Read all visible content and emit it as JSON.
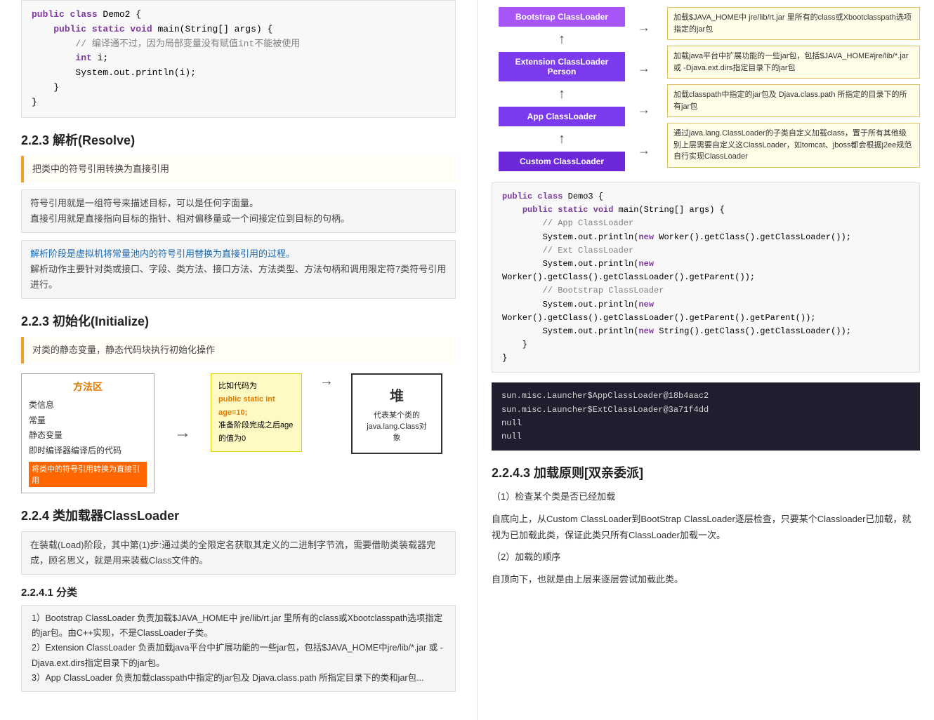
{
  "left": {
    "code_top": {
      "lines": [
        {
          "text": "public class Demo2 {",
          "type": "normal"
        },
        {
          "text": "    public static void main(String[] args) {",
          "type": "normal"
        },
        {
          "text": "        // 编译通不过，因为局部变量没有赋值int不能被使用",
          "type": "comment"
        },
        {
          "text": "        int i;",
          "type": "indent"
        },
        {
          "text": "        System.out.println(i);",
          "type": "indent"
        },
        {
          "text": "    }",
          "type": "normal"
        },
        {
          "text": "}",
          "type": "normal"
        }
      ]
    },
    "section_223": {
      "title": "2.2.3 解析(Resolve)",
      "infobox": "把类中的符号引用转换为直接引用",
      "box1_line1": "符号引用就是一组符号来描述目标，可以是任何字面量。",
      "box1_line2": "直接引用就是直接指向目标的指针、相对偏移量或一个间接定位到目标的句柄。",
      "box2_line1": "解析阶段是虚拟机将常量池内的符号引用替换为直接引用的过程。",
      "box2_line2": "解析动作主要针对类或接口、字段、类方法、接口方法、方法类型、方法句柄和调用限定符7类符号引用进行。"
    },
    "section_223_init": {
      "title": "2.2.3 初始化(Initialize)",
      "desc": "对类的静态变量，静态代码块执行初始化操作"
    },
    "diagram": {
      "method_area_title": "方法区",
      "method_area_items": [
        "类信息",
        "常量",
        "静态变量",
        "即时编译器编译后的代码"
      ],
      "method_area_footer": "将类中的符号引用转换为直接引用",
      "sticky_line1": "比如代码为",
      "sticky_highlight": "public static int age=10;",
      "sticky_line2": "准备阶段完成之后age的值为0",
      "heap_title": "堆",
      "heap_desc": "代表某个类的",
      "heap_desc2": "java.lang.Class对象"
    },
    "section_224": {
      "title": "2.2.4 类加载器ClassLoader",
      "infobox": "在装载(Load)阶段，其中第(1)步:通过类的全限定名获取其定义的二进制字节流，需要借助类装载器完成，顾名思义，就是用来装载Class文件的。",
      "subsection_241_title": "2.2.4.1 分类",
      "code_list_line1": "1）Bootstrap ClassLoader 负责加载$JAVA_HOME中 jre/lib/rt.jar 里所有的class或Xbootclasspath选项指定的jar包。由C++实现，不是ClassLoader子类。",
      "code_list_line2": "2）Extension ClassLoader 负责加载java平台中扩展功能的一些jar包，包括$JAVA_HOME中jre/lib/*.jar 或 -Djava.ext.dirs指定目录下的jar包。",
      "code_list_line3": "3）App ClassLoader 负责加载classpath中指定的jar包及 Djava.class.path 所指定目录下的类和jar包..."
    }
  },
  "right": {
    "classloader_diagram": {
      "bootstrap_label": "Bootstrap ClassLoader",
      "extension_label": "Extension ClassLoader  Person",
      "app_label": "App ClassLoader",
      "custom_label": "Custom ClassLoader",
      "desc1": "加载$JAVA_HOME中 jre/lib/rt.jar 里所有的class或Xbootclasspath选项指定的jar包",
      "desc2": "加载java平台中扩展功能的一些jar包，包括$JAVA_HOME#jre/lib/*.jar 或 -Djava.ext.dirs指定目录下的jar包",
      "desc3": "加载classpath中指定的jar包及 Djava.class.path 所指定的目录下的所有jar包",
      "desc4": "通过java.lang.ClassLoader的子类自定义加载class，置于所有其他级别上层需要自定义这ClassLoader，如tomcat、jboss都会根据j2ee规范自行实现ClassLoader"
    },
    "code_demo3": {
      "lines": [
        "public class Demo3 {",
        "    public static void main(String[] args) {",
        "        // App ClassLoader",
        "        System.out.println(new Worker().getClass().getClassLoader());",
        "        // Ext ClassLoader",
        "        System.out.println(new",
        "Worker().getClass().getClassLoader().getParent());",
        "        // Bootstrap ClassLoader",
        "        System.out.println(new",
        "Worker().getClass().getClassLoader().getParent().getParent());",
        "        System.out.println(new String().getClass().getClassLoader());",
        "    }",
        "}"
      ]
    },
    "output": {
      "lines": [
        "sun.misc.Launcher$AppClassLoader@18b4aac2",
        "sun.misc.Launcher$ExtClassLoader@3a71f4dd",
        "null",
        "null"
      ]
    },
    "section_2243": {
      "title": "2.2.4.3 加载原则[双亲委派]",
      "step1_title": "（1）检查某个类是否已经加载",
      "step1_desc": "自底向上，从Custom ClassLoader到BootStrap ClassLoader逐层检查，只要某个Classloader已加载，就视为已加载此类，保证此类只所有ClassLoader加载一次。",
      "step2_title": "（2）加载的顺序",
      "step2_desc": "自顶向下，也就是由上层来逐层尝试加载此类。"
    }
  }
}
